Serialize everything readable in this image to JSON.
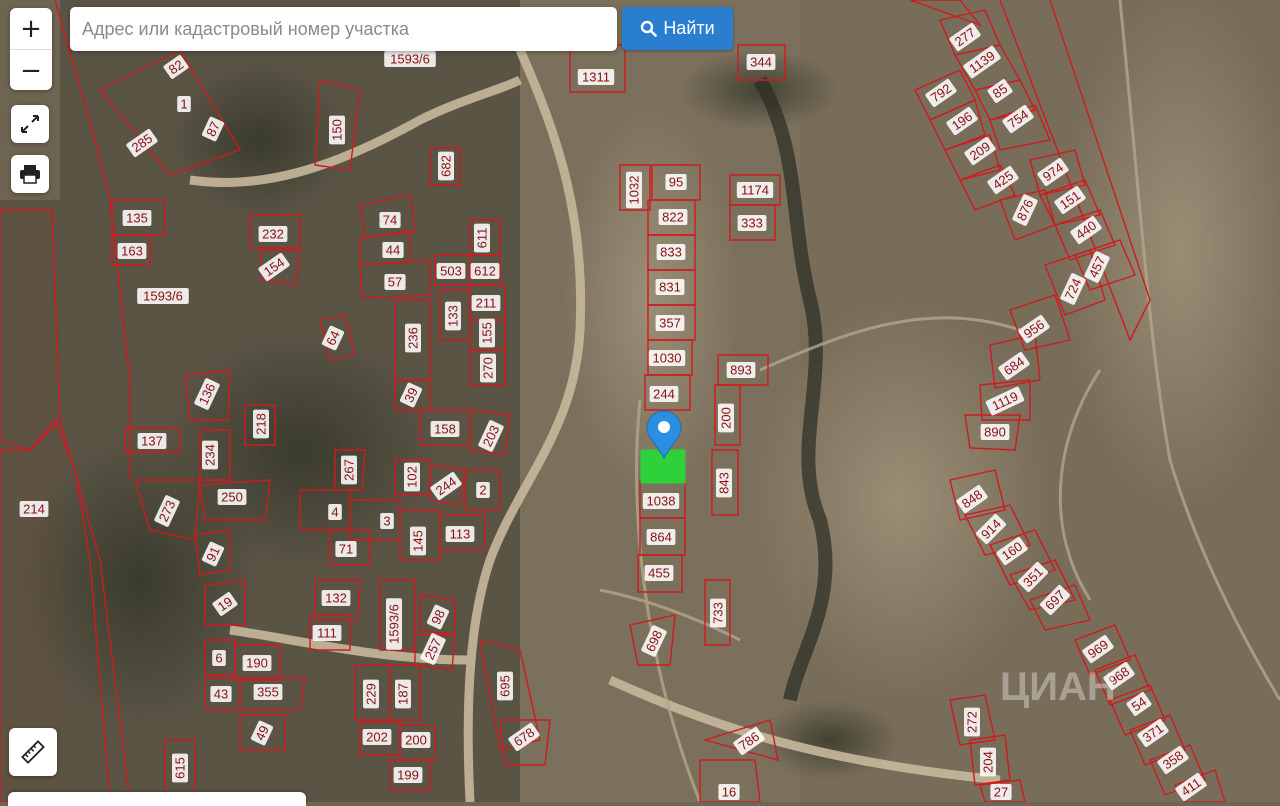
{
  "search": {
    "placeholder": "Адрес или кадастровый номер участка",
    "value": "",
    "button_label": "Найти"
  },
  "controls": {
    "zoom_in": "+",
    "zoom_out": "−",
    "fullscreen_icon": "expand-icon",
    "print_icon": "printer-icon",
    "ruler_icon": "ruler-icon"
  },
  "colors": {
    "parcel_border": "#d01a1f",
    "selected_parcel": "#2fd13a",
    "marker": "#2a8fe0",
    "search_button": "#2a7ed0"
  },
  "plots": [
    "1311",
    "344",
    "277",
    "1139",
    "792",
    "85",
    "196",
    "754",
    "209",
    "425",
    "974",
    "151",
    "876",
    "440",
    "457",
    "724",
    "82",
    "1",
    "87",
    "285",
    "150",
    "682",
    "1032",
    "95",
    "1174",
    "822",
    "333",
    "833",
    "831",
    "357",
    "1030",
    "244",
    "893",
    "135",
    "163",
    "232",
    "154",
    "74",
    "44",
    "57",
    "503",
    "612",
    "611",
    "211",
    "133",
    "155",
    "270",
    "236",
    "64",
    "39",
    "1593/6",
    "158",
    "203",
    "136",
    "218",
    "137",
    "234",
    "267",
    "102",
    "244",
    "2",
    "250",
    "273",
    "214",
    "4",
    "3",
    "145",
    "113",
    "91",
    "71",
    "19",
    "132",
    "1593/6",
    "111",
    "98",
    "257",
    "6",
    "190",
    "43",
    "355",
    "229",
    "187",
    "49",
    "202",
    "200",
    "199",
    "615",
    "695",
    "678",
    "1038",
    "864",
    "455",
    "843",
    "200",
    "733",
    "698",
    "786",
    "16",
    "956",
    "684",
    "1119",
    "890",
    "848",
    "914",
    "160",
    "351",
    "697",
    "969",
    "968",
    "54",
    "371",
    "358",
    "411",
    "272",
    "204",
    "27",
    "1593/6"
  ],
  "watermark": "ЦИАН"
}
